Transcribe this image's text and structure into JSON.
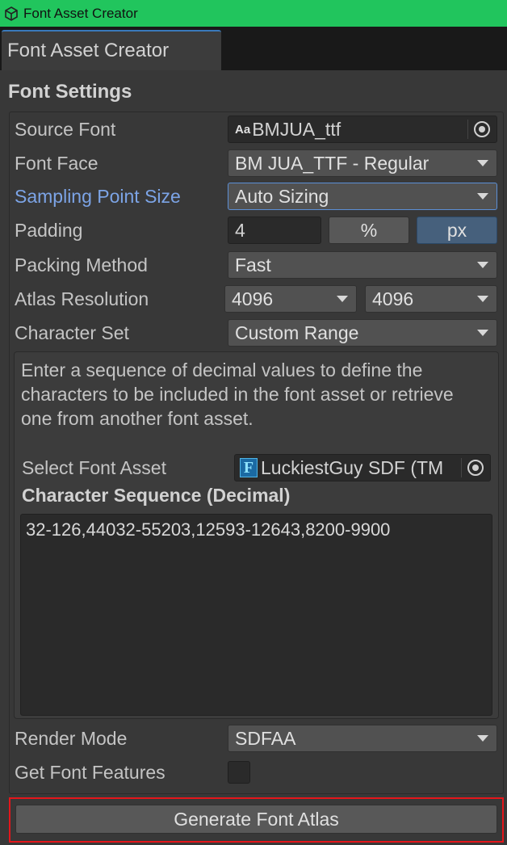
{
  "window": {
    "title": "Font Asset Creator",
    "tab": "Font Asset Creator"
  },
  "settings": {
    "heading": "Font Settings",
    "source_font": {
      "label": "Source Font",
      "value": "BMJUA_ttf",
      "icon": "Aa"
    },
    "font_face": {
      "label": "Font Face",
      "value": "BM JUA_TTF - Regular"
    },
    "sampling_point_size": {
      "label": "Sampling Point Size",
      "value": "Auto Sizing"
    },
    "padding": {
      "label": "Padding",
      "value": "4",
      "percent_label": "%",
      "px_label": "px",
      "unit_selected": "px"
    },
    "packing_method": {
      "label": "Packing Method",
      "value": "Fast"
    },
    "atlas_resolution": {
      "label": "Atlas Resolution",
      "width": "4096",
      "height": "4096"
    },
    "character_set": {
      "label": "Character Set",
      "value": "Custom Range"
    },
    "help_text": "Enter a sequence of decimal values to define the characters to be included in the font asset or retrieve one from another font asset.",
    "select_font_asset": {
      "label": "Select Font Asset",
      "value": "LuckiestGuy SDF (TM",
      "icon": "F"
    },
    "character_sequence": {
      "label": "Character Sequence (Decimal)",
      "value": "32-126,44032-55203,12593-12643,8200-9900"
    },
    "render_mode": {
      "label": "Render Mode",
      "value": "SDFAA"
    },
    "get_font_features": {
      "label": "Get Font Features",
      "checked": false
    }
  },
  "actions": {
    "generate_label": "Generate Font Atlas"
  },
  "colors": {
    "titlebar": "#21c55d",
    "accent": "#7ca4e6",
    "highlight": "#e4161b",
    "selected": "#46607c"
  }
}
